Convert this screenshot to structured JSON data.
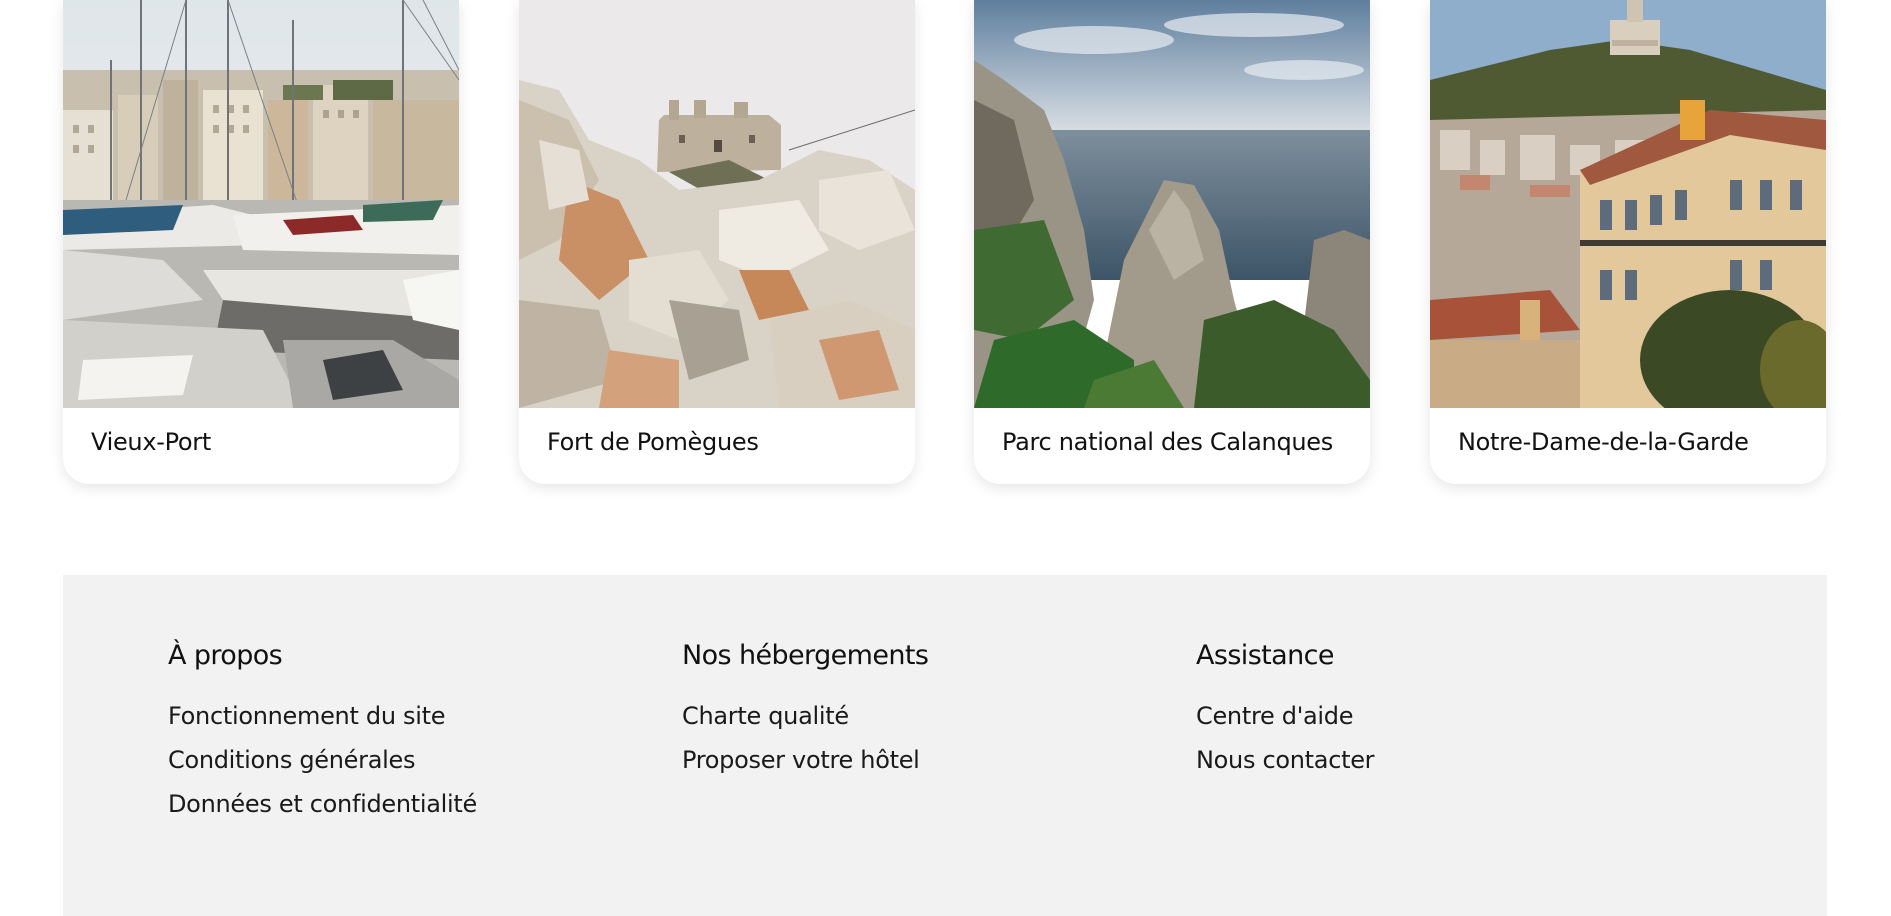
{
  "cards": [
    {
      "title": "Vieux-Port",
      "image": "harbor-boats-photo"
    },
    {
      "title": "Fort de Pomègues",
      "image": "rocky-fort-photo"
    },
    {
      "title": "Parc national des Calanques",
      "image": "calanques-cliffs-photo"
    },
    {
      "title": "Notre-Dame-de-la-Garde",
      "image": "basilica-hill-city-photo"
    }
  ],
  "footer": {
    "columns": [
      {
        "heading": "À propos",
        "links": [
          "Fonctionnement du site",
          "Conditions générales",
          "Données et confidentialité"
        ]
      },
      {
        "heading": "Nos hébergements",
        "links": [
          "Charte qualité",
          "Proposer votre hôtel"
        ]
      },
      {
        "heading": "Assistance",
        "links": [
          "Centre d'aide",
          "Nous contacter"
        ]
      }
    ],
    "background": "#f2f2f2"
  },
  "colors": {
    "text": "#111111",
    "card_background": "#ffffff"
  }
}
